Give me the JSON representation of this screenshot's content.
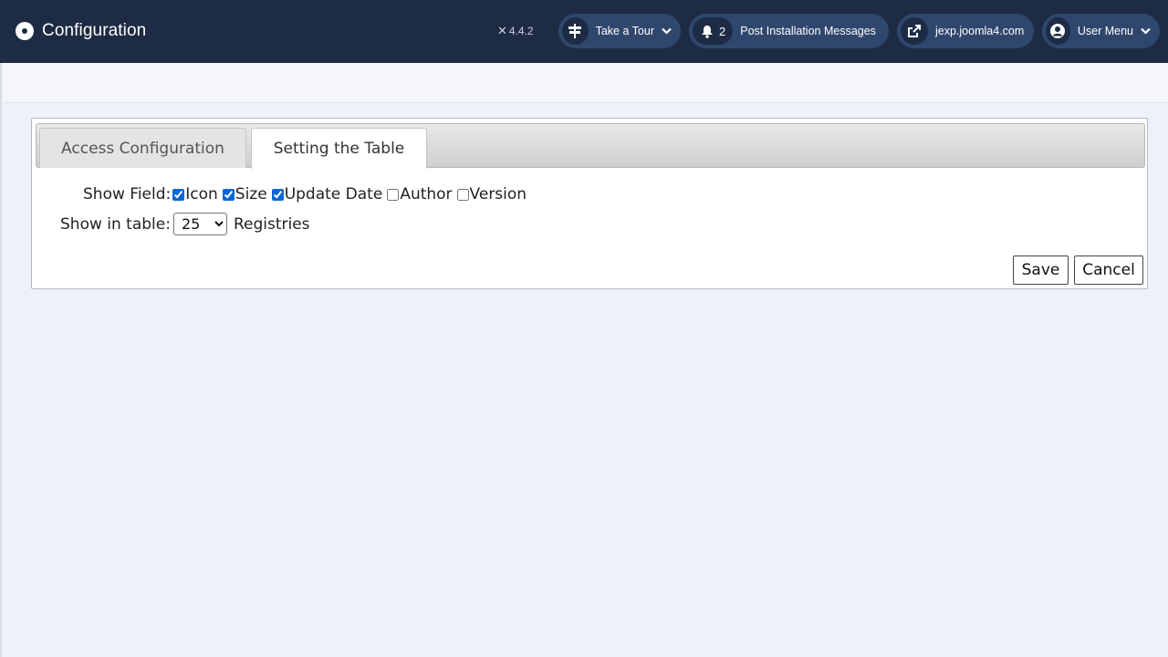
{
  "header": {
    "title": "Configuration",
    "version": "4.4.2",
    "take_tour": "Take a Tour",
    "notifications_count": "2",
    "post_install": "Post Installation Messages",
    "site_link": "jexp.joomla4.com",
    "user_menu": "User Menu"
  },
  "tabs": {
    "access": "Access Configuration",
    "table": "Setting the Table"
  },
  "form": {
    "show_field_label": "Show Field:",
    "fields": [
      {
        "label": "Icon",
        "checked": true
      },
      {
        "label": "Size",
        "checked": true
      },
      {
        "label": "Update Date",
        "checked": true
      },
      {
        "label": "Author",
        "checked": false
      },
      {
        "label": "Version",
        "checked": false
      }
    ],
    "show_in_table_label": "Show in table:",
    "rows_value": "25",
    "rows_suffix": "Registries"
  },
  "buttons": {
    "save": "Save",
    "cancel": "Cancel"
  },
  "colors": {
    "header_bg": "#1d2b45",
    "pill_bg": "#30476d",
    "page_bg": "#edf1f9",
    "checkbox_accent": "#0a66d6"
  },
  "icons": {
    "brand": "joomla-circle-icon",
    "version": "joomla-x-icon",
    "tour": "signpost-icon",
    "notifications": "bell-icon",
    "site": "external-link-icon",
    "user": "user-circle-icon"
  }
}
